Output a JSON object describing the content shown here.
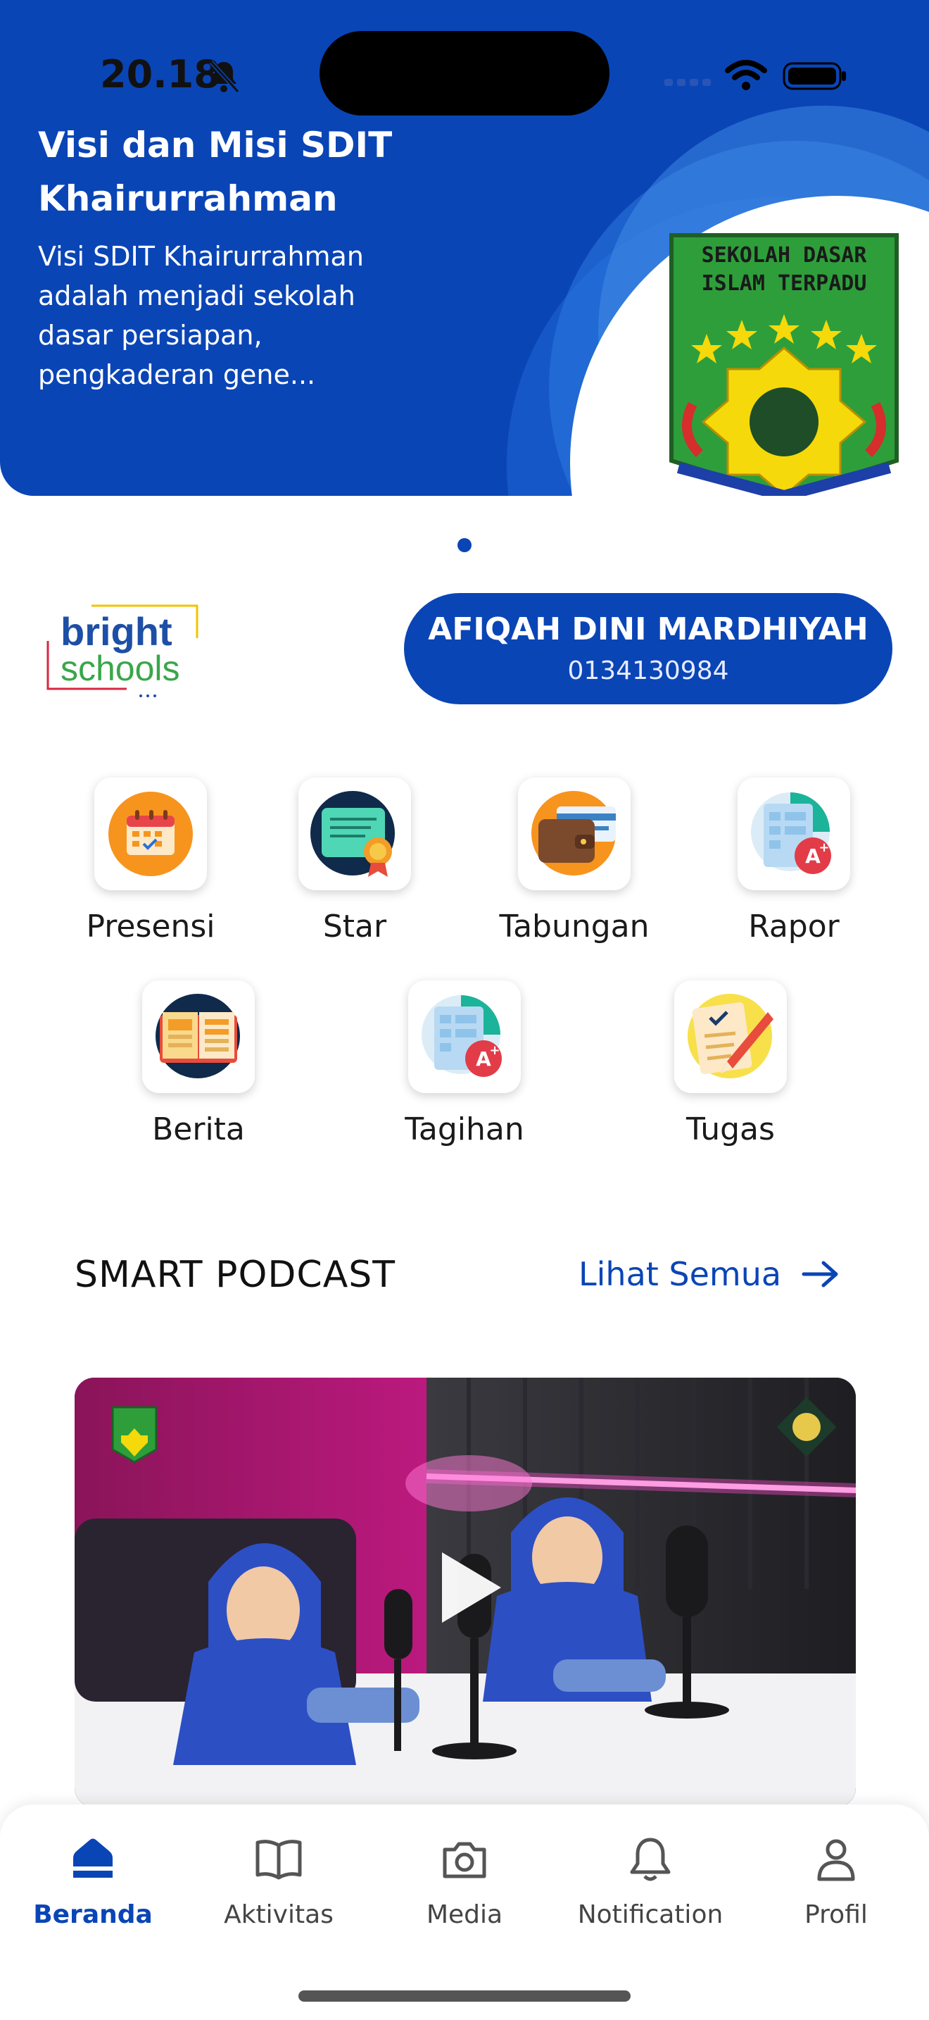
{
  "status_bar": {
    "time": "20.18"
  },
  "banner": {
    "title": "Visi dan Misi SDIT Khairurrahman",
    "description": "Visi SDIT Khairurrahman adalah menjadi sekolah dasar persiapan, pengkaderan gene...",
    "logo_text_top": "SEKOLAH DASAR",
    "logo_text_bottom": "ISLAM TERPADU"
  },
  "brand": {
    "line1": "bright",
    "line2": "schools"
  },
  "user": {
    "name": "AFIQAH DINI MARDHIYAH",
    "id": "0134130984"
  },
  "menu": {
    "row1": [
      {
        "label": "Presensi",
        "icon": "calendar-icon"
      },
      {
        "label": "Star",
        "icon": "certificate-icon"
      },
      {
        "label": "Tabungan",
        "icon": "wallet-icon"
      },
      {
        "label": "Rapor",
        "icon": "report-card-icon"
      }
    ],
    "row2": [
      {
        "label": "Berita",
        "icon": "newspaper-icon"
      },
      {
        "label": "Tagihan",
        "icon": "bill-icon"
      },
      {
        "label": "Tugas",
        "icon": "assignment-icon"
      }
    ]
  },
  "podcast": {
    "title": "SMART PODCAST",
    "see_all": "Lihat Semua"
  },
  "nav": [
    {
      "label": "Beranda",
      "icon": "home-icon",
      "active": true
    },
    {
      "label": "Aktivitas",
      "icon": "book-icon",
      "active": false
    },
    {
      "label": "Media",
      "icon": "camera-icon",
      "active": false
    },
    {
      "label": "Notification",
      "icon": "bell-icon",
      "active": false
    },
    {
      "label": "Profil",
      "icon": "person-icon",
      "active": false
    }
  ],
  "colors": {
    "primary": "#0a45b6",
    "white": "#ffffff"
  }
}
